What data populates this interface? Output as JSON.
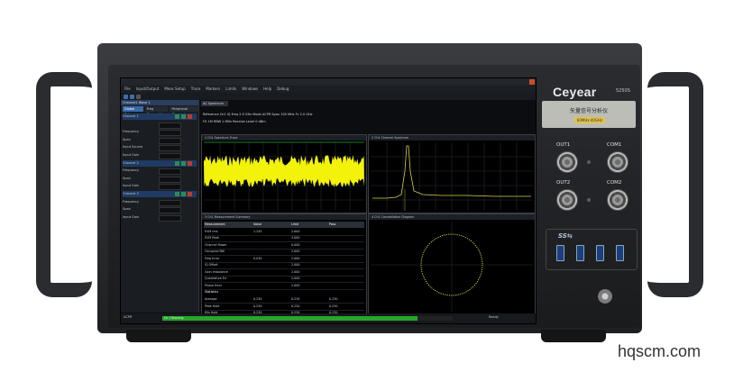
{
  "screen": {
    "menu": [
      "File",
      "Input/Output",
      "Meas Setup",
      "Trace",
      "Markers",
      "Limits",
      "Windows",
      "Help",
      "Debug"
    ],
    "left_panel": {
      "header": "Channel1 Wave 1",
      "tabs": [
        "Global Setup",
        "Freq Channel 1",
        "Peripheral Channel"
      ],
      "rows": [
        {
          "label": "Channel 1",
          "header": true
        },
        {
          "label": "",
          "value": ""
        },
        {
          "label": "Frequency",
          "value": ""
        },
        {
          "label": "Span",
          "value": ""
        },
        {
          "label": "Input Source",
          "value": ""
        },
        {
          "label": "Input Gain",
          "value": ""
        },
        {
          "label": "Channel 2",
          "header": true
        },
        {
          "label": "Frequency",
          "value": ""
        },
        {
          "label": "Span",
          "value": ""
        },
        {
          "label": "Input Gain",
          "value": ""
        },
        {
          "label": "Channel 3",
          "header": true
        },
        {
          "label": "Frequency",
          "value": ""
        },
        {
          "label": "Span",
          "value": ""
        },
        {
          "label": "Input Gain",
          "value": ""
        }
      ]
    },
    "content": {
      "tab": "AC Spectrum",
      "info_line_1": "Reference  Ch1  IQ Freq 2.0 GHz  Mode  ACPR  Span 100 MHz  Fc 2.0 GHz",
      "info_line_2": "FX        1M        RBW  1 MHz          Receive Level  0 dBm",
      "windows": [
        {
          "title": "1 Ch1  Spectrum  Trace"
        },
        {
          "title": "2 Ch1  Channel Spectrum"
        },
        {
          "title": "3 Ch1  Measurement Summary"
        },
        {
          "title": "4 Ch1  Constellation Diagram"
        }
      ],
      "table": {
        "header": [
          "Measurement",
          "Value",
          "Limit",
          "Pass"
        ],
        "rows": [
          [
            "EVM rms",
            "1.245",
            "2.000",
            ""
          ],
          [
            "EVM Peak",
            "",
            "3.000",
            ""
          ],
          [
            "Channel Power",
            "",
            "0.000",
            ""
          ],
          [
            "Occupied BW",
            "",
            "2.000",
            ""
          ],
          [
            "Freq Error",
            "0.030",
            "2.000",
            ""
          ],
          [
            "IQ Offset",
            "",
            "2.000",
            ""
          ],
          [
            "Gain Imbalance",
            "",
            "2.000",
            ""
          ],
          [
            "Quadrature Err",
            "",
            "2.000",
            ""
          ],
          [
            "Phase Error",
            "",
            "2.000",
            ""
          ]
        ],
        "section2": "Statistics",
        "rows2": [
          [
            "Average",
            "0.230",
            "0.230",
            "0.230"
          ],
          [
            "Peak Hold",
            "0.230",
            "0.230",
            "0.230"
          ],
          [
            "Min Hold",
            "0.230",
            "0.230",
            "0.230"
          ],
          [
            "Std Dev",
            "0.230",
            "0.230",
            "0.230"
          ]
        ]
      }
    },
    "status": {
      "left": "ACPR",
      "progress_label": "Ch 1 Running",
      "progress": 0.88,
      "right": "Ready"
    }
  },
  "front_panel": {
    "brand": "Ceyear",
    "model": "5250S",
    "plate_text": "矢量信号分析仪",
    "plate_badge": "60MHz-40GHz",
    "ports": [
      "OUT1",
      "COM1",
      "OUT2",
      "COM2"
    ],
    "usb_logo": "SS⇆"
  },
  "watermark": "hqscm.com"
}
